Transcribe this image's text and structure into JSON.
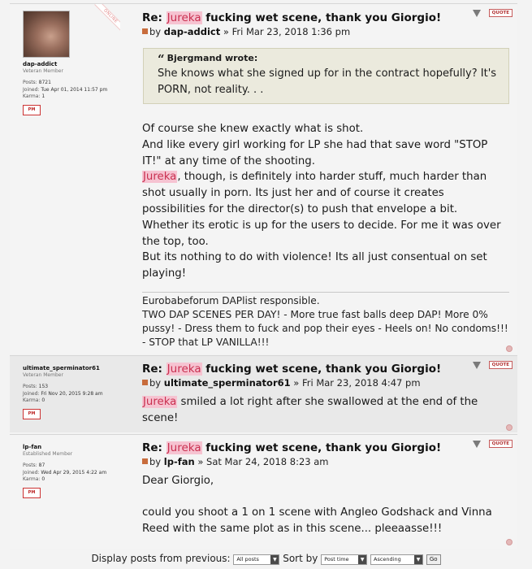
{
  "posts": [
    {
      "profile": {
        "username": "dap-addict",
        "rank": "Veteran Member",
        "posts_label": "Posts:",
        "posts": "8721",
        "joined_label": "Joined:",
        "joined": "Tue Apr 01, 2014 11:57 pm",
        "karma_label": "Karma:",
        "karma": "1",
        "online_label": "ONLINE",
        "pm_label": "PM"
      },
      "title_prefix": "Re: ",
      "title_highlight": "Jureka",
      "title_suffix": " fucking wet scene, thank you Giorgio!",
      "by": "by",
      "author": "dap-addict",
      "date": "» Fri Mar 23, 2018 1:36 pm",
      "quote": {
        "cite": "Bjergmand wrote:",
        "text": "She knows what she signed up for in the contract hopefully? It's PORN, not reality. . ."
      },
      "lines": [
        "Of course she knew exactly what is shot.",
        "And like every girl working for LP she had that save word \"STOP IT!\" at any time of the shooting."
      ],
      "para_highlight": "Jureka",
      "para_rest": ", though, is definitely into harder stuff, much harder than shot usually in porn. Its just her and of course it creates possibilities for the director(s) to push that envelope a bit.",
      "lines_after": [
        "Whether its erotic is up for the users to decide. For me it was over the top, too.",
        "But its nothing to do with violence! Its all just consentual on set playing!"
      ],
      "signature": [
        "Eurobabeforum DAPlist responsible.",
        "TWO DAP SCENES PER DAY! - More true fast balls deep DAP! More 0% pussy! - Dress them to fuck and pop their eyes - Heels on! No condoms!!! - STOP that LP VANILLA!!!"
      ]
    },
    {
      "profile": {
        "username": "ultimate_sperminator61",
        "rank": "Veteran Member",
        "posts_label": "Posts:",
        "posts": "153",
        "joined_label": "Joined:",
        "joined": "Fri Nov 20, 2015 9:28 am",
        "karma_label": "Karma:",
        "karma": "0",
        "pm_label": "PM"
      },
      "title_prefix": "Re: ",
      "title_highlight": "Jureka",
      "title_suffix": " fucking wet scene, thank you Giorgio!",
      "by": "by",
      "author": "ultimate_sperminator61",
      "date": "» Fri Mar 23, 2018 4:47 pm",
      "body_highlight": "Jureka",
      "body_rest": " smiled a lot right after she swallowed at the end of the scene!"
    },
    {
      "profile": {
        "username": "lp-fan",
        "rank": "Established Member",
        "posts_label": "Posts:",
        "posts": "87",
        "joined_label": "Joined:",
        "joined": "Wed Apr 29, 2015 4:22 am",
        "karma_label": "Karma:",
        "karma": "0",
        "pm_label": "PM"
      },
      "title_prefix": "Re: ",
      "title_highlight": "Jureka",
      "title_suffix": " fucking wet scene, thank you Giorgio!",
      "by": "by",
      "author": "lp-fan",
      "date": "» Sat Mar 24, 2018 8:23 am",
      "greeting": "Dear Giorgio,",
      "body": "could you shoot a 1 on 1 scene with Angleo Godshack and Vinna Reed with the same plot as in this scene... pleeaasse!!!"
    }
  ],
  "post_tools": {
    "quote_label": "QUOTE"
  },
  "footer": {
    "display_label": "Display posts from previous:",
    "display_value": "All posts",
    "sort_label": "Sort by",
    "sort_value": "Post time",
    "order_value": "Ascending",
    "go_label": "Go"
  }
}
